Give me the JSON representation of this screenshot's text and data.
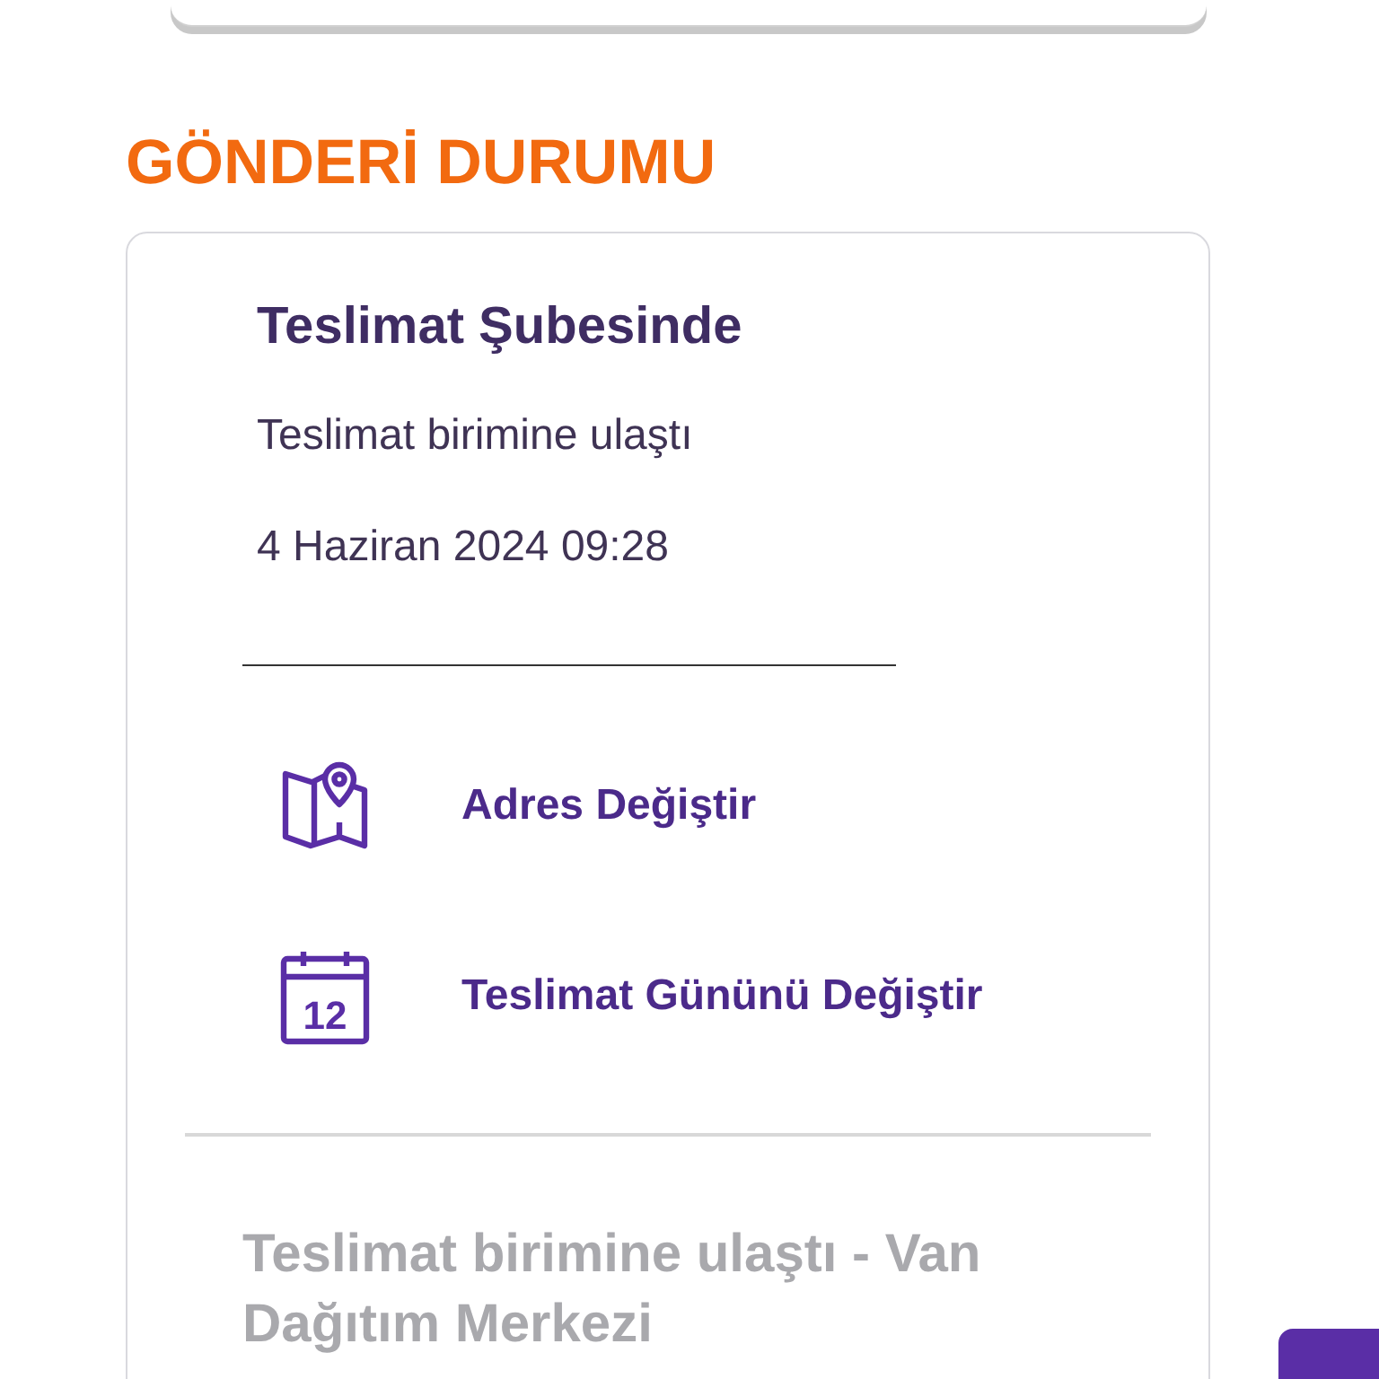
{
  "section_title": "GÖNDERİ DURUMU",
  "status": {
    "title": "Teslimat Şubesinde",
    "description": "Teslimat birimine ulaştı",
    "date": "4 Haziran 2024 09:28"
  },
  "actions": [
    {
      "kind": "map",
      "label": "Adres Değiştir"
    },
    {
      "kind": "calendar",
      "label": "Teslimat Gününü Değiştir",
      "icon_text": "12"
    }
  ],
  "history": [
    {
      "text": "Teslimat birimine ulaştı - Van Dağıtım Merkezi"
    }
  ]
}
